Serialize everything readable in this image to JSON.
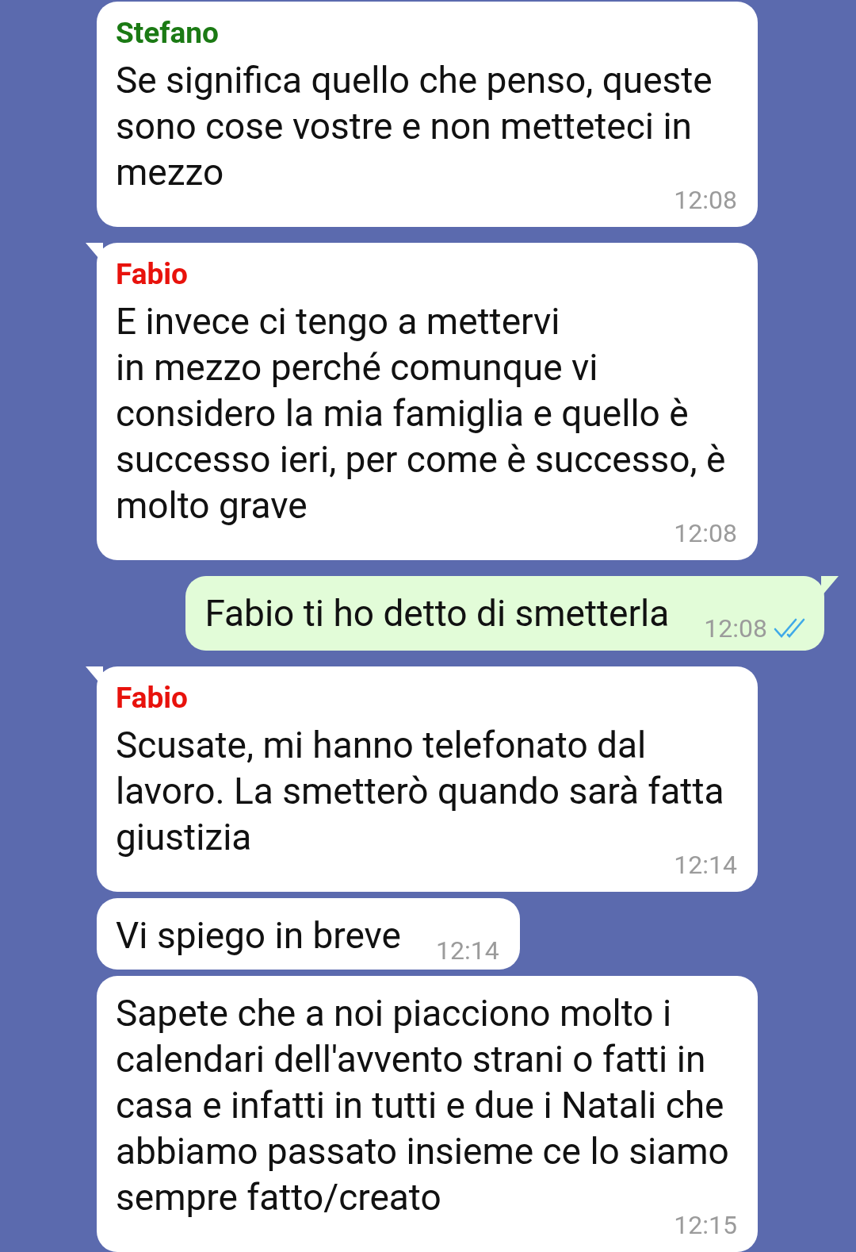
{
  "messages": [
    {
      "kind": "incoming",
      "tail": false,
      "sender": {
        "name": "Stefano",
        "color": "#1b7a14"
      },
      "text": "Se significa quello che penso, queste sono cose vostre e non metteteci in mezzo",
      "time": "12:08"
    },
    {
      "kind": "incoming",
      "tail": true,
      "sender": {
        "name": "Fabio",
        "color": "#e8120c"
      },
      "text": "E invece ci tengo a mettervi\nin mezzo perché comunque vi considero la mia famiglia e quello è successo ieri, per come è successo, è molto grave",
      "time": "12:08"
    },
    {
      "kind": "outgoing",
      "tail": true,
      "text": "Fabio ti ho detto di smetterla",
      "time": "12:08",
      "read": true
    },
    {
      "kind": "incoming",
      "tail": true,
      "sender": {
        "name": "Fabio",
        "color": "#e8120c"
      },
      "text": "Scusate, mi hanno telefonato dal lavoro. La smetterò quando sarà fatta giustizia",
      "time": "12:14"
    },
    {
      "kind": "incoming",
      "tail": false,
      "text": "Vi spiego in breve",
      "time": "12:14"
    },
    {
      "kind": "incoming",
      "tail": false,
      "text": "Sapete che a noi piacciono molto i calendari dell'avvento strani o fatti in casa e infatti in tutti e due i Natali che abbiamo passato insieme ce lo siamo sempre fatto/creato",
      "time": "12:15"
    }
  ]
}
